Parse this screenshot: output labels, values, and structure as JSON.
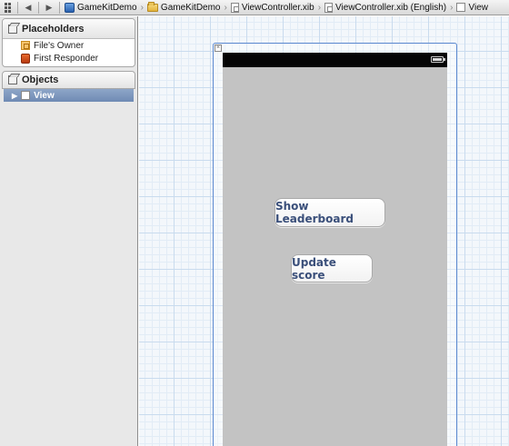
{
  "jumpbar": {
    "crumbs": [
      {
        "label": "GameKitDemo",
        "icon": "project-icon"
      },
      {
        "label": "GameKitDemo",
        "icon": "folder-icon"
      },
      {
        "label": "ViewController.xib",
        "icon": "xib-file-icon"
      },
      {
        "label": "ViewController.xib (English)",
        "icon": "xib-file-icon"
      },
      {
        "label": "View",
        "icon": "view-icon"
      }
    ]
  },
  "placeholders": {
    "title": "Placeholders",
    "items": [
      "File's Owner",
      "First Responder"
    ]
  },
  "objects": {
    "title": "Objects",
    "items": [
      "View"
    ]
  },
  "canvas": {
    "buttons": {
      "leaderboard": "Show Leaderboard",
      "update": "Update score"
    }
  },
  "colors": {
    "accent": "#5d8ad0",
    "selection": "#7f98bf",
    "view_background": "#c3c3c3",
    "button_text": "#3a4f7a"
  }
}
